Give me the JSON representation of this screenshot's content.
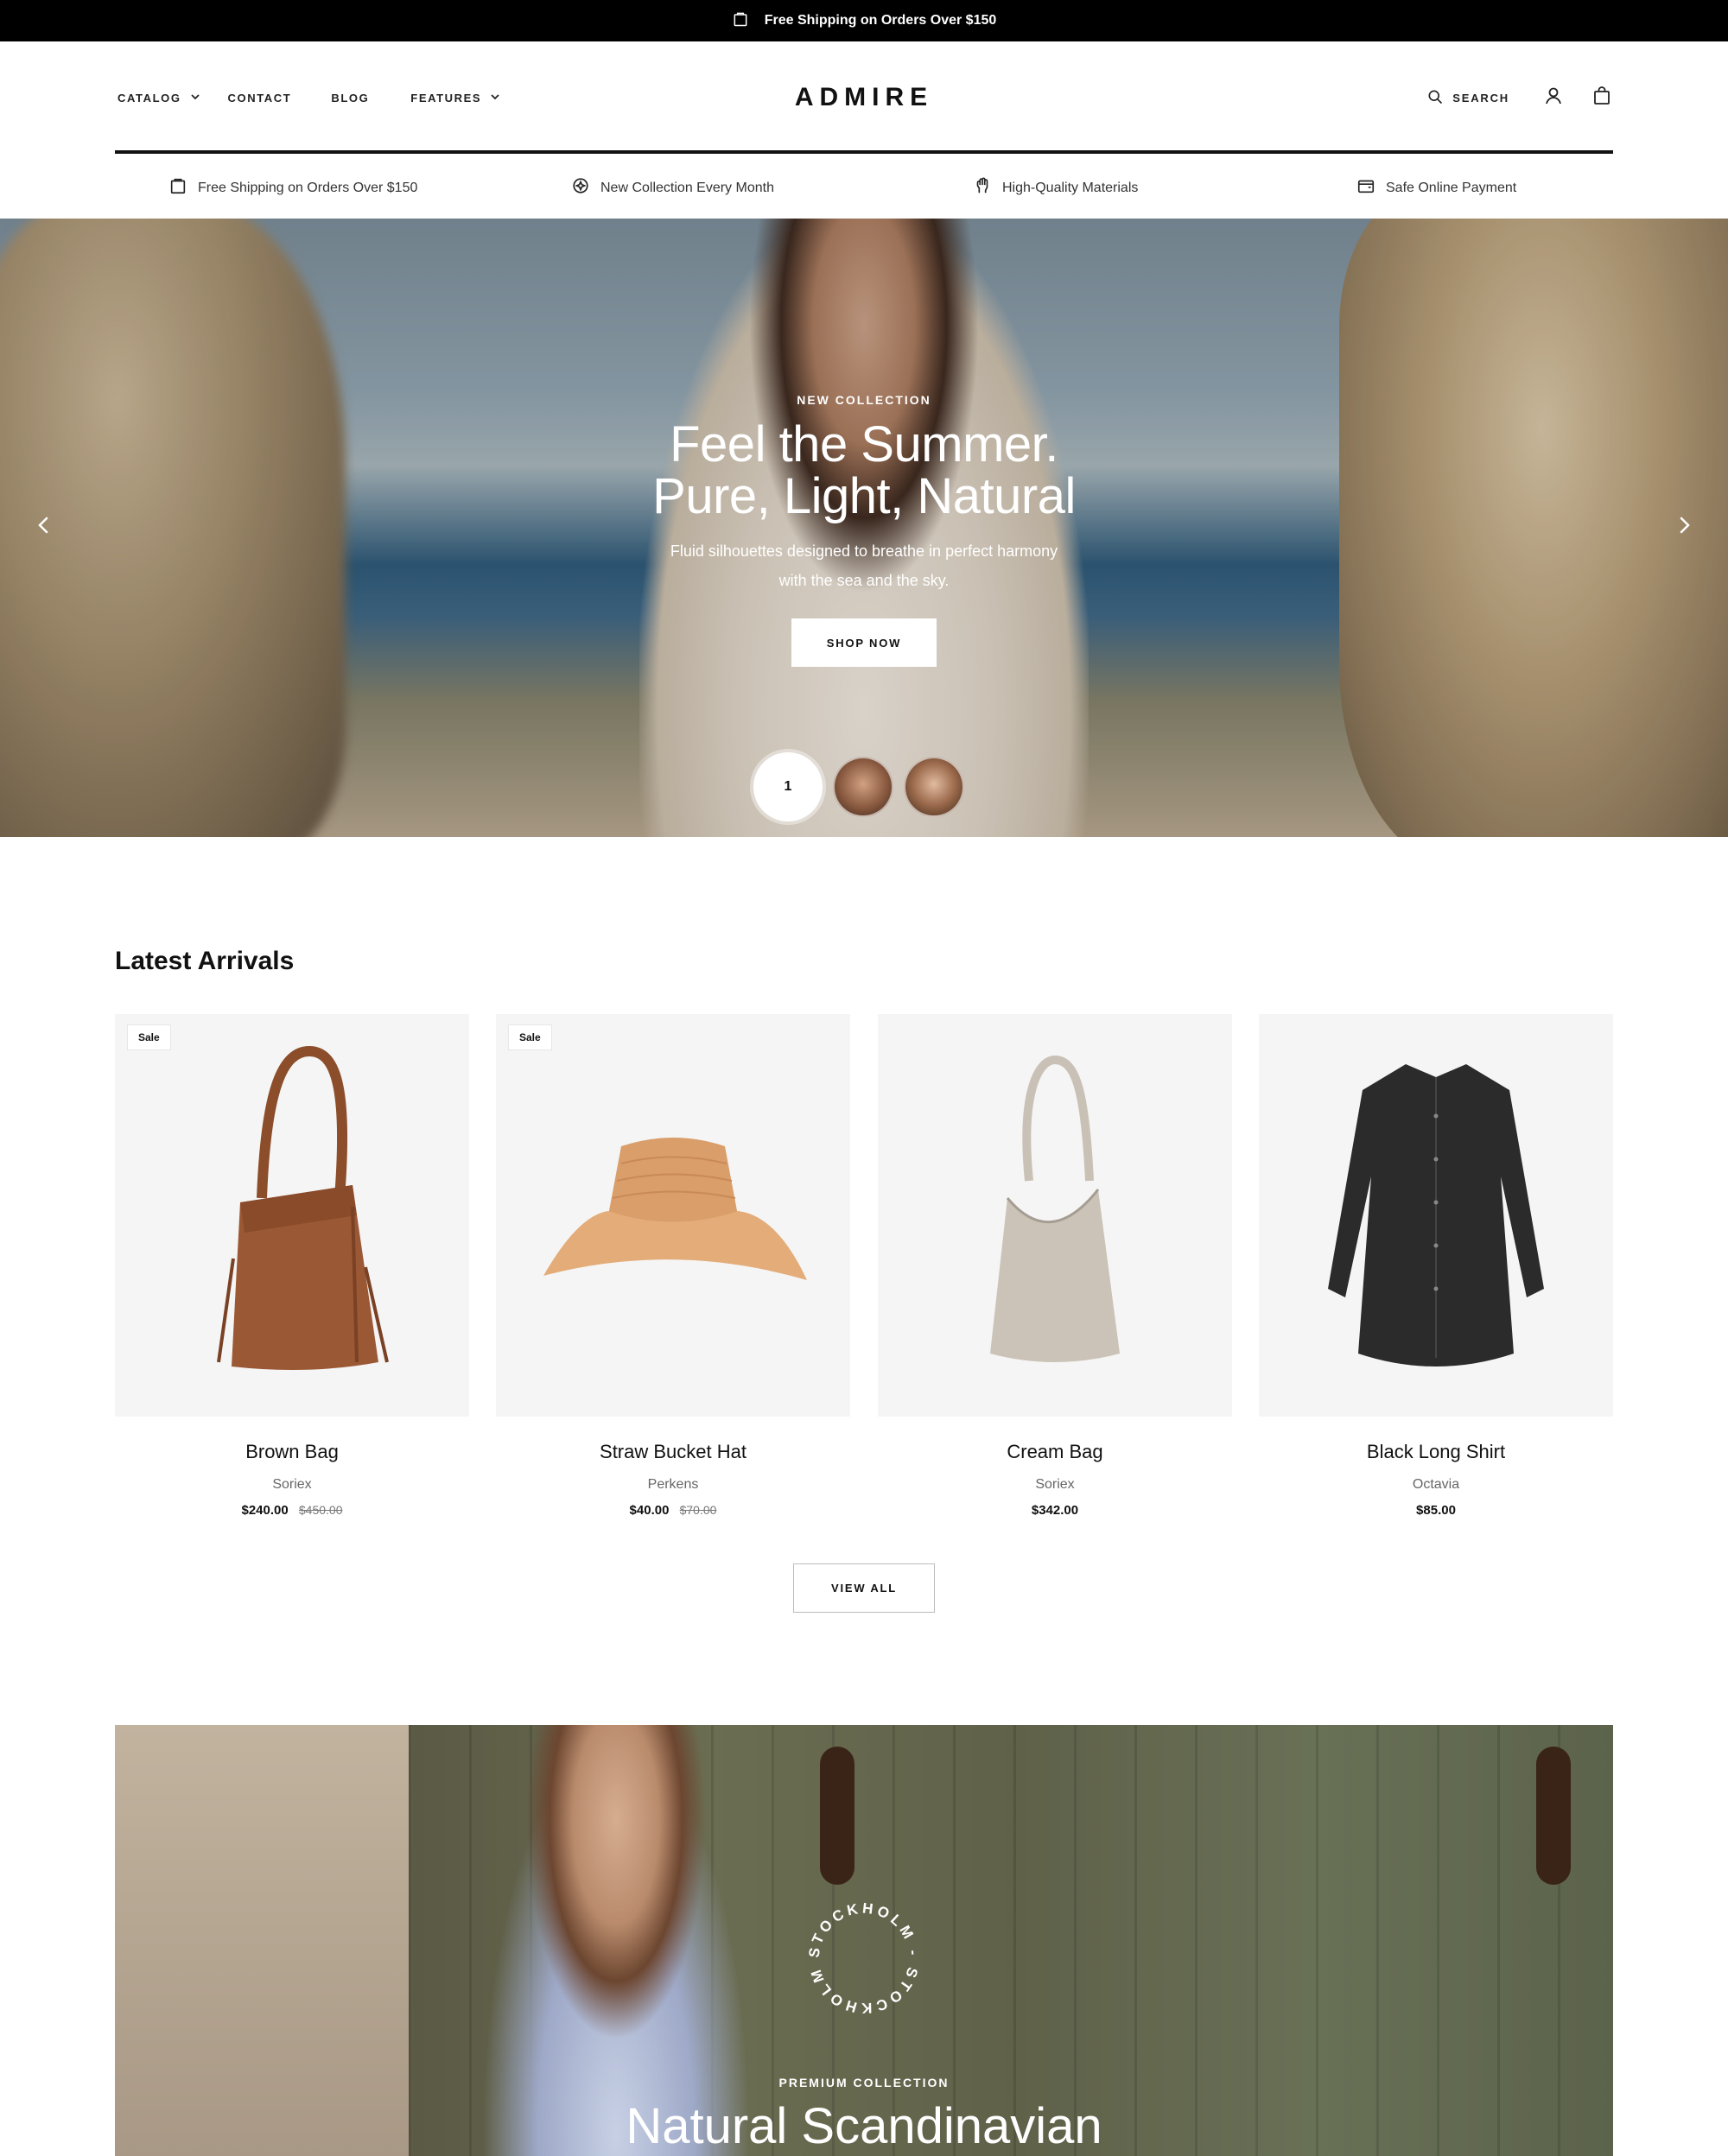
{
  "announcement": {
    "text": "Free Shipping on Orders Over $150",
    "icon": "shopping-bag-icon"
  },
  "nav": {
    "items": [
      {
        "label": "CATALOG",
        "has_dropdown": true
      },
      {
        "label": "CONTACT",
        "has_dropdown": false
      },
      {
        "label": "BLOG",
        "has_dropdown": false
      },
      {
        "label": "FEATURES",
        "has_dropdown": true
      }
    ]
  },
  "brand": {
    "logo_text": "ADMIRE"
  },
  "header_actions": {
    "search_label": "SEARCH",
    "account_icon": "user-icon",
    "cart_icon": "bag-icon"
  },
  "usps": [
    {
      "icon": "shopping-bag-icon",
      "label": "Free Shipping on Orders Over $150"
    },
    {
      "icon": "sparkle-icon",
      "label": "New Collection Every Month"
    },
    {
      "icon": "hand-icon",
      "label": "High-Quality Materials"
    },
    {
      "icon": "wallet-icon",
      "label": "Safe Online Payment"
    }
  ],
  "hero": {
    "eyebrow": "NEW COLLECTION",
    "title_line1": "Feel the Summer.",
    "title_line2": "Pure, Light, Natural",
    "subtitle_line1": "Fluid silhouettes designed to breathe in perfect harmony",
    "subtitle_line2": "with the sea and the sky.",
    "button_label": "SHOP NOW",
    "slide_indicator": "1"
  },
  "latest_arrivals": {
    "title": "Latest Arrivals",
    "products": [
      {
        "name": "Brown Bag",
        "vendor": "Soriex",
        "price": "$240.00",
        "compare_price": "$450.00",
        "badge": "Sale"
      },
      {
        "name": "Straw Bucket Hat",
        "vendor": "Perkens",
        "price": "$40.00",
        "compare_price": "$70.00",
        "badge": "Sale"
      },
      {
        "name": "Cream Bag",
        "vendor": "Soriex",
        "price": "$342.00",
        "compare_price": "",
        "badge": ""
      },
      {
        "name": "Black Long Shirt",
        "vendor": "Octavia",
        "price": "$85.00",
        "compare_price": "",
        "badge": ""
      }
    ],
    "view_all_label": "VIEW ALL"
  },
  "banner": {
    "stamp_text": "STOCKHOLM - STOCKHOLM -",
    "eyebrow": "PREMIUM COLLECTION",
    "title": "Natural Scandinavian"
  },
  "colors": {
    "announcement_bg": "#000000",
    "accent": "#111111",
    "card_bg": "#f5f5f5"
  }
}
